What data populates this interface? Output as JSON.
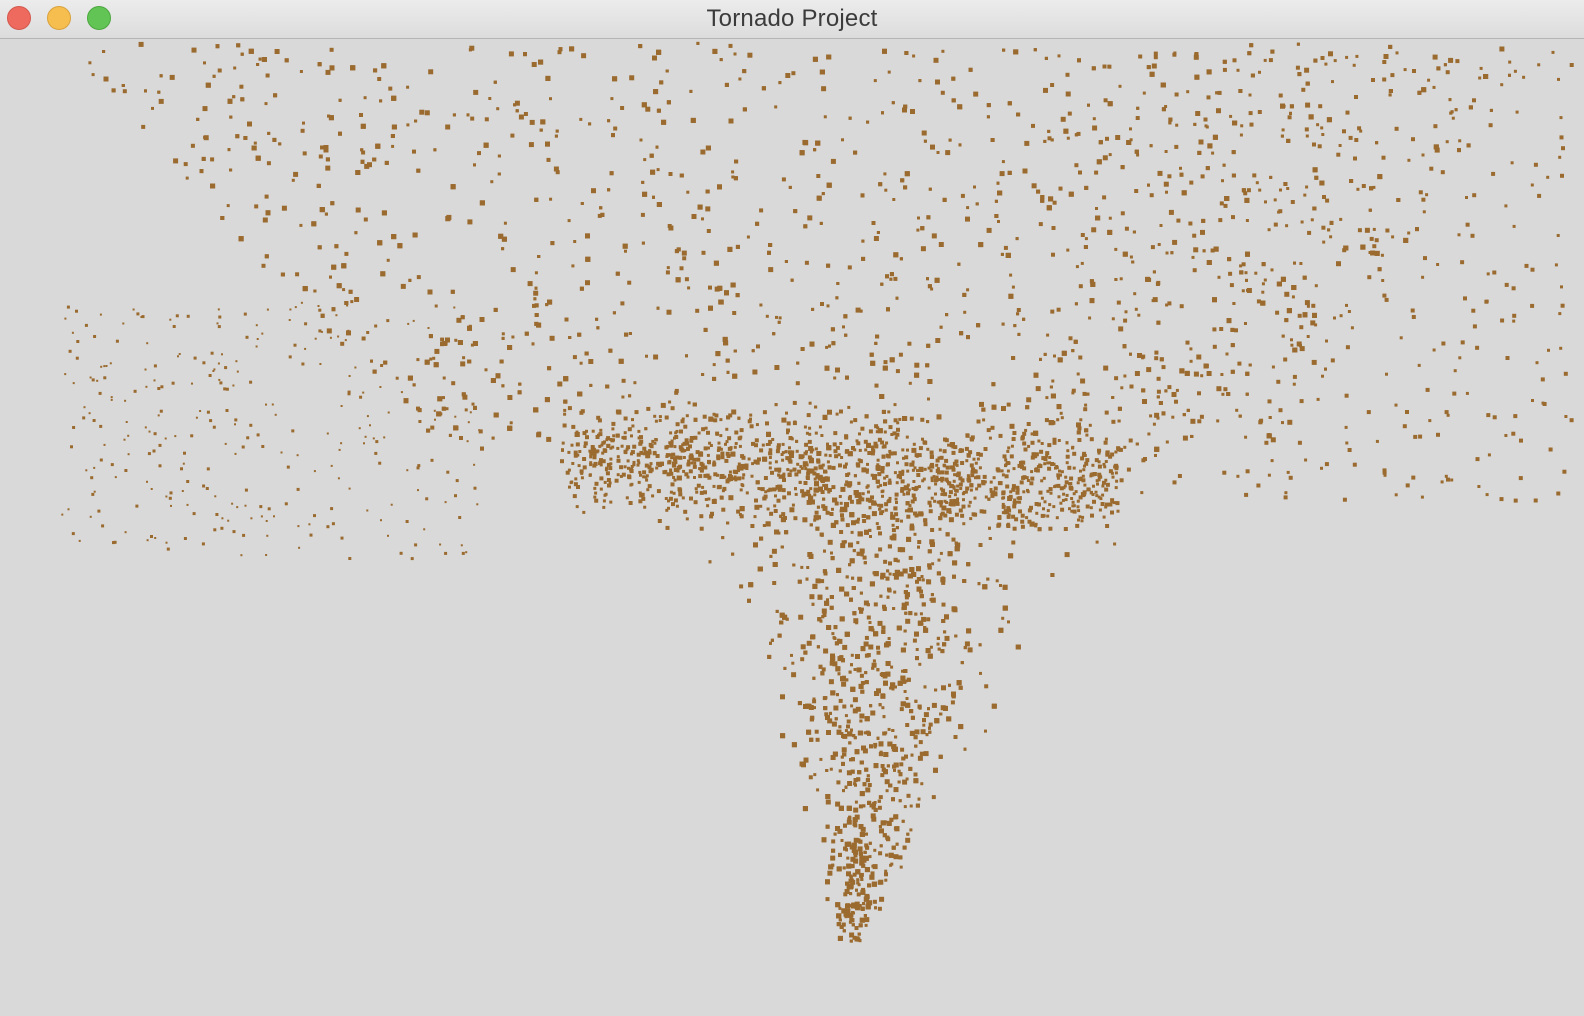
{
  "window": {
    "title": "Tornado Project",
    "controls": {
      "close": "close-button",
      "minimize": "minimize-button",
      "zoom": "zoom-button"
    }
  },
  "scene": {
    "background_color": "#d9d9d9",
    "particle_color": "#9a6a2f",
    "particle_shape": "tornado-funnel"
  }
}
